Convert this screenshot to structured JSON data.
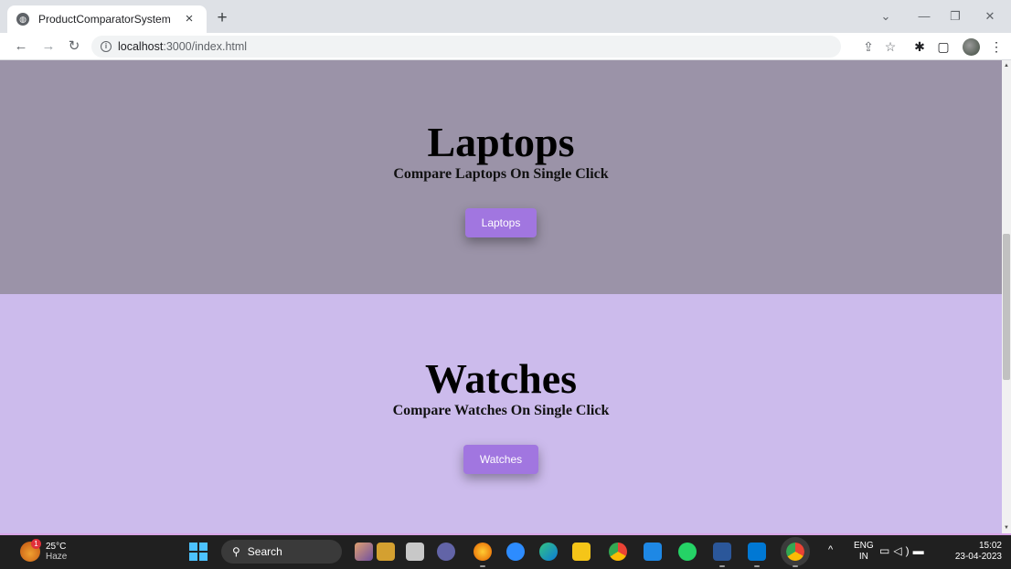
{
  "browser": {
    "tab_title": "ProductComparatorSystem",
    "tab_close": "×",
    "new_tab": "+",
    "url_host": "localhost",
    "url_rest": ":3000/index.html"
  },
  "sections": [
    {
      "heading": "Laptops",
      "subheading": "Compare Laptops On Single Click",
      "button_label": "Laptops",
      "background": "#9b93a8"
    },
    {
      "heading": "Watches",
      "subheading": "Compare Watches On Single Click",
      "button_label": "Watches",
      "background": "#ccbbec"
    }
  ],
  "accent_color": "#a176e0",
  "taskbar": {
    "weather_temp": "25°C",
    "weather_condition": "Haze",
    "weather_badge": "1",
    "search_label": "Search",
    "lang_line1": "ENG",
    "lang_line2": "IN",
    "time": "15:02",
    "date": "23-04-2023"
  }
}
